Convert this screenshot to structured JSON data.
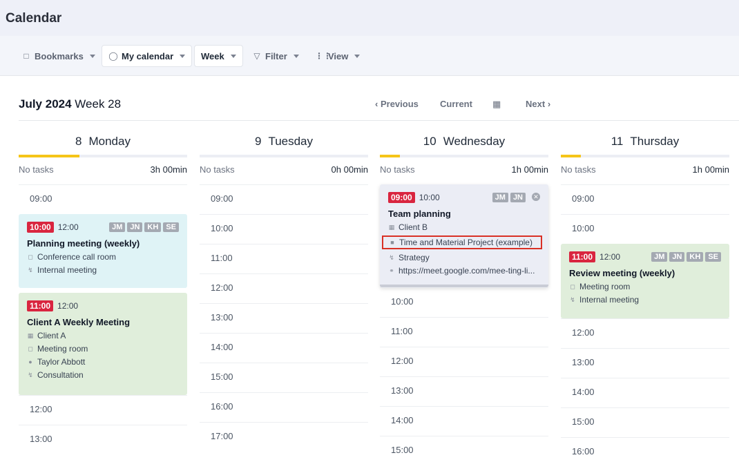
{
  "app": {
    "title": "Calendar"
  },
  "toolbar": {
    "bookmarks": "Bookmarks",
    "my_calendar": "My calendar",
    "week": "Week",
    "filter": "Filter",
    "view": "View"
  },
  "period": {
    "month": "July 2024",
    "week": "Week 28"
  },
  "nav": {
    "previous": "Previous",
    "current": "Current",
    "next": "Next"
  },
  "days": [
    {
      "num": "8",
      "name": "Monday",
      "tasks": "No tasks",
      "duration": "3h 00min",
      "progress": 0.36,
      "slots": [
        "09:00",
        "12:00",
        "13:00"
      ],
      "events": [
        {
          "start": "10:00",
          "end": "12:00",
          "badges": [
            "JM",
            "JN",
            "KH",
            "SE"
          ],
          "title": "Planning meeting (weekly)",
          "lines": [
            {
              "icon": "cube-icon",
              "text": "Conference call room"
            },
            {
              "icon": "bolt-icon",
              "text": "Internal meeting"
            }
          ]
        },
        {
          "start": "11:00",
          "end": "12:00",
          "badges": [],
          "title": "Client A Weekly Meeting",
          "lines": [
            {
              "icon": "building-icon",
              "text": "Client A"
            },
            {
              "icon": "cube-icon",
              "text": "Meeting room"
            },
            {
              "icon": "person-icon",
              "text": "Taylor Abbott"
            },
            {
              "icon": "bolt-icon",
              "text": "Consultation"
            }
          ]
        }
      ]
    },
    {
      "num": "9",
      "name": "Tuesday",
      "tasks": "No tasks",
      "duration": "0h 00min",
      "progress": 0,
      "slots": [
        "09:00",
        "10:00",
        "11:00",
        "12:00",
        "13:00",
        "14:00",
        "15:00",
        "16:00",
        "17:00"
      ],
      "events": []
    },
    {
      "num": "10",
      "name": "Wednesday",
      "tasks": "No tasks",
      "duration": "1h 00min",
      "progress": 0.12,
      "slots": [
        "10:00",
        "11:00",
        "12:00",
        "13:00",
        "14:00",
        "15:00"
      ],
      "events": [
        {
          "start": "09:00",
          "end": "10:00",
          "badges": [
            "JM",
            "JN"
          ],
          "title": "Team planning",
          "lines": [
            {
              "icon": "building-icon",
              "text": "Client B"
            },
            {
              "icon": "briefcase-icon",
              "text": "Time and Material Project (example)"
            },
            {
              "icon": "bolt-icon",
              "text": "Strategy"
            },
            {
              "icon": "headset-icon",
              "text": "https://meet.google.com/mee-ting-li..."
            }
          ]
        }
      ]
    },
    {
      "num": "11",
      "name": "Thursday",
      "tasks": "No tasks",
      "duration": "1h 00min",
      "progress": 0.12,
      "slots": [
        "09:00",
        "10:00",
        "12:00",
        "13:00",
        "14:00",
        "15:00",
        "16:00"
      ],
      "events": [
        {
          "start": "11:00",
          "end": "12:00",
          "badges": [
            "JM",
            "JN",
            "KH",
            "SE"
          ],
          "title": "Review meeting (weekly)",
          "lines": [
            {
              "icon": "cube-icon",
              "text": "Meeting room"
            },
            {
              "icon": "bolt-icon",
              "text": "Internal meeting"
            }
          ]
        }
      ]
    }
  ],
  "colors": {
    "accent": "#f5c518",
    "start_time": "#d9253f",
    "event_cyan": "#dff3f6",
    "event_green": "#e0eedb",
    "highlight": "#d93025"
  }
}
